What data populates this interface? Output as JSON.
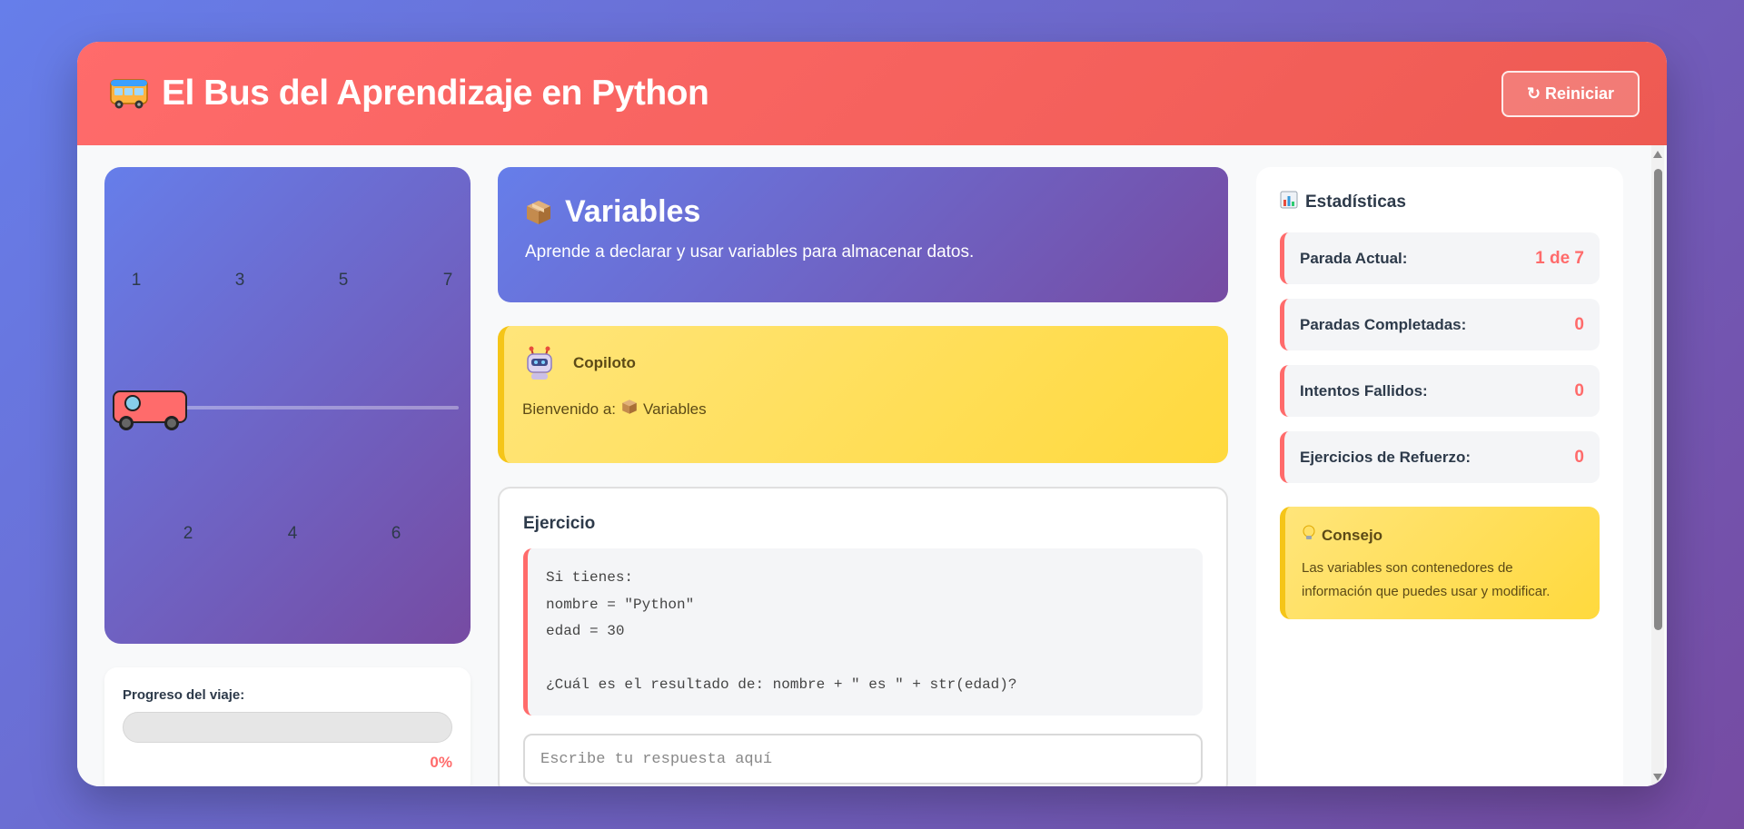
{
  "header": {
    "icon": "bus-icon",
    "title": "El Bus del Aprendizaje en Python",
    "reset_label": "↻ Reiniciar"
  },
  "route": {
    "top_stops": [
      "1",
      "3",
      "5",
      "7"
    ],
    "bottom_stops": [
      "2",
      "4",
      "6"
    ]
  },
  "progress": {
    "label": "Progreso del viaje:",
    "percent": 0,
    "percent_text": "0%"
  },
  "lesson": {
    "icon": "box-icon",
    "title": "Variables",
    "description": "Aprende a declarar y usar variables para almacenar datos."
  },
  "copilot": {
    "icon": "robot-icon",
    "name": "Copiloto",
    "message_prefix": "Bienvenido a:",
    "message_topic": "Variables"
  },
  "exercise": {
    "title": "Ejercicio",
    "code": "Si tienes:\nnombre = \"Python\"\nedad = 30\n\n¿Cuál es el resultado de: nombre + \" es \" + str(edad)?",
    "input_placeholder": "Escribe tu respuesta aquí",
    "input_value": ""
  },
  "stats": {
    "icon": "chart-icon",
    "title": "Estadísticas",
    "items": [
      {
        "label": "Parada Actual:",
        "value": "1 de 7"
      },
      {
        "label": "Paradas Completadas:",
        "value": "0"
      },
      {
        "label": "Intentos Fallidos:",
        "value": "0"
      },
      {
        "label": "Ejercicios de Refuerzo:",
        "value": "0"
      }
    ]
  },
  "tip": {
    "icon": "lightbulb-icon",
    "title": "Consejo",
    "text": "Las variables son contenedores de información que puedes usar y modificar."
  },
  "colors": {
    "accent": "#ff6b6b",
    "purple_start": "#667eea",
    "purple_end": "#764ba2",
    "yellow": "#ffd93d"
  }
}
